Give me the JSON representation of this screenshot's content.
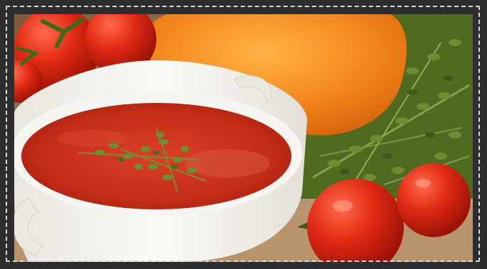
{
  "image": {
    "subject": "tomato-soup-photo"
  },
  "colors": {
    "frame": "#2c2d2f",
    "border_dash": "#d9d9d9",
    "soup": "#c8321c",
    "bowl": "#f4f1ea",
    "pepper": "#f08a1c",
    "tomato": "#d8291a",
    "herbs": "#5d7a2c"
  }
}
